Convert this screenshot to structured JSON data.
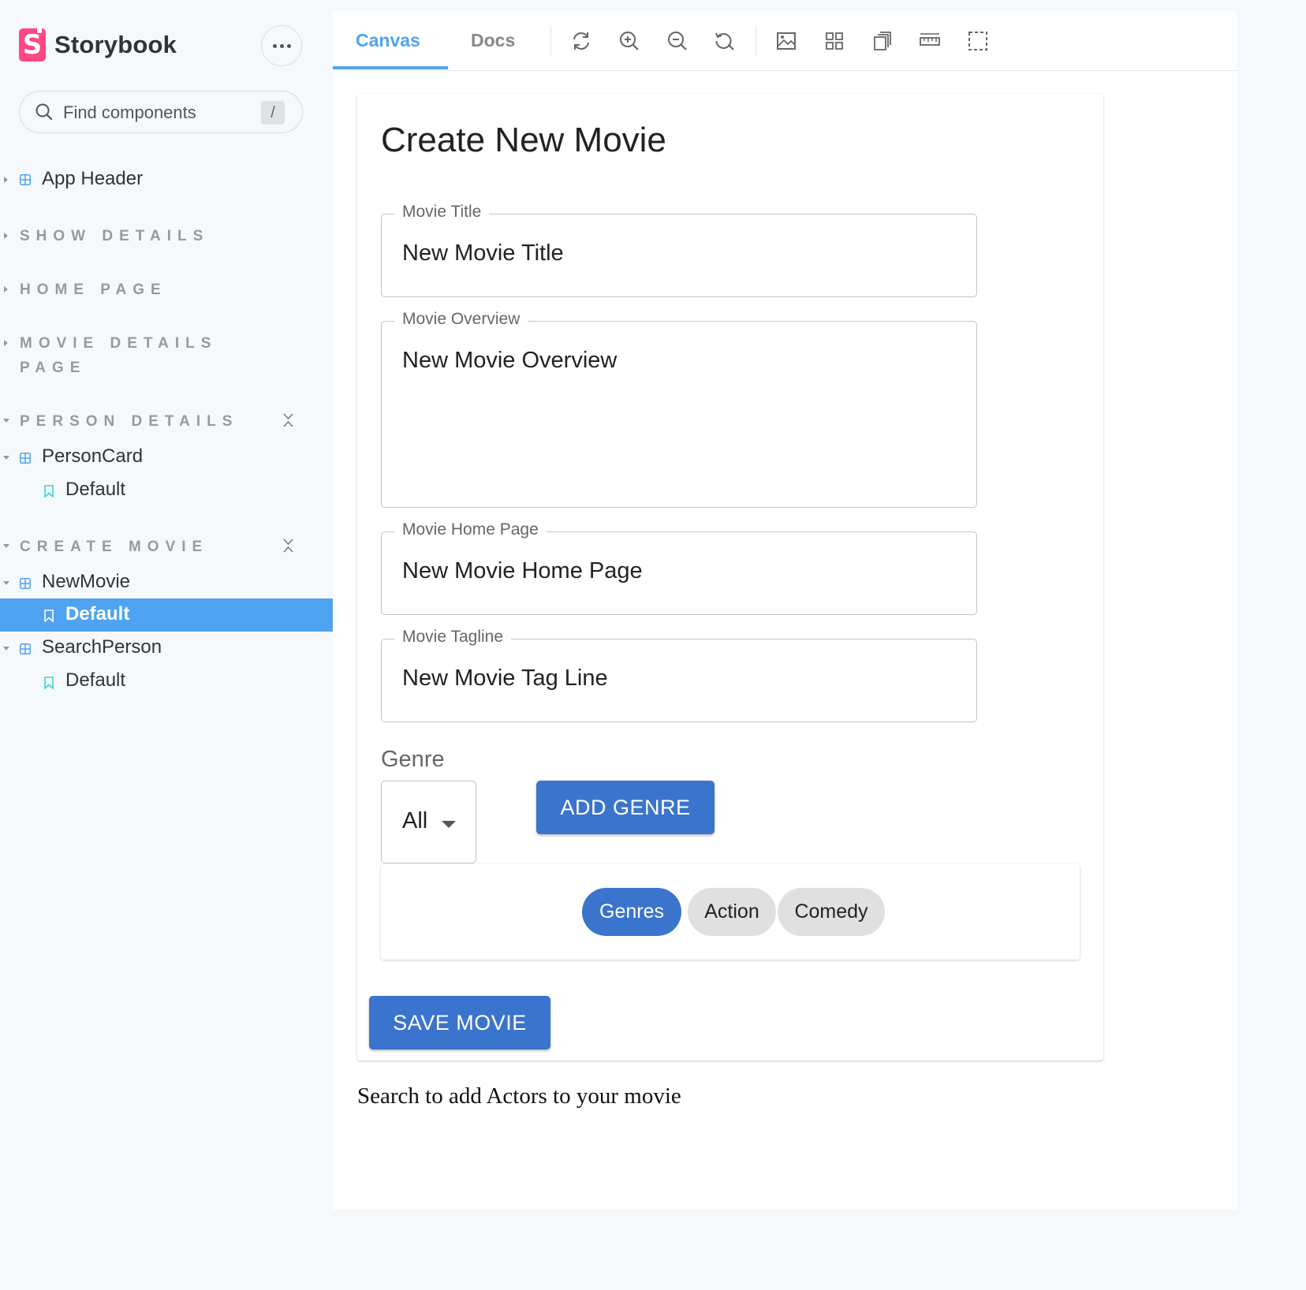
{
  "sidebar": {
    "brand": "Storybook",
    "search_placeholder": "Find components",
    "search_shortcut": "/",
    "items": [
      {
        "label": "App Header",
        "type": "component"
      },
      {
        "label": "SHOW DETAILS",
        "type": "group"
      },
      {
        "label": "HOME PAGE",
        "type": "group"
      },
      {
        "label": "MOVIE DETAILS PAGE",
        "type": "group"
      },
      {
        "label": "PERSON DETAILS",
        "type": "group"
      },
      {
        "label": "PersonCard",
        "type": "component"
      },
      {
        "label": "Default",
        "type": "story"
      },
      {
        "label": "CREATE MOVIE",
        "type": "group"
      },
      {
        "label": "NewMovie",
        "type": "component"
      },
      {
        "label": "Default",
        "type": "story",
        "selected": true
      },
      {
        "label": "SearchPerson",
        "type": "component"
      },
      {
        "label": "Default",
        "type": "story"
      }
    ],
    "movie_details_lines": [
      "MOVIE DETAILS",
      "PAGE"
    ]
  },
  "toolbar": {
    "tabs": [
      {
        "label": "Canvas",
        "active": true
      },
      {
        "label": "Docs",
        "active": false
      }
    ],
    "tools": [
      "reload-icon",
      "zoom-in-icon",
      "zoom-out-icon",
      "zoom-reset-icon",
      "background-icon",
      "grid-icon",
      "viewport-icon",
      "measure-icon",
      "outline-icon"
    ]
  },
  "form": {
    "title": "Create New Movie",
    "fields": [
      {
        "label": "Movie Title",
        "value": "New Movie Title"
      },
      {
        "label": "Movie Overview",
        "value": "New Movie Overview"
      },
      {
        "label": "Movie Home Page",
        "value": "New Movie Home Page"
      },
      {
        "label": "Movie Tagline",
        "value": "New Movie Tag Line"
      }
    ],
    "genre_label": "Genre",
    "genre_selected": "All",
    "add_genre_button": "ADD GENRE",
    "chips": [
      "Genres",
      "Action",
      "Comedy"
    ],
    "save_button": "SAVE MOVIE"
  },
  "actors_text": "Search to add Actors to your movie",
  "colors": {
    "accent": "#4fa3f1",
    "brand": "#ff4785",
    "button": "#3a74cc",
    "sidebar_bg": "#f6f9fc"
  }
}
